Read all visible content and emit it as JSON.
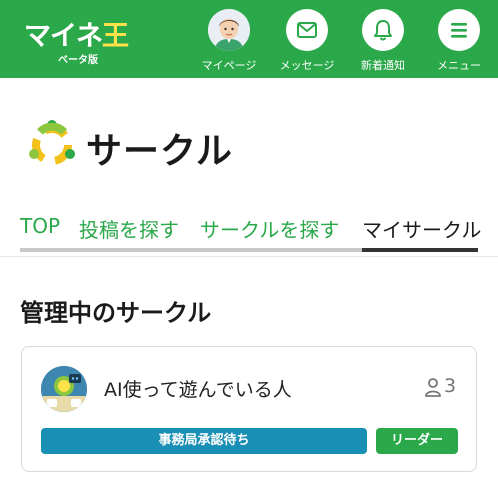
{
  "header": {
    "logo_text_main": "マイネ",
    "logo_text_accent": "王",
    "logo_sub": "ベータ版",
    "nav": [
      {
        "label": "マイページ",
        "icon": "avatar"
      },
      {
        "label": "メッセージ",
        "icon": "mail-icon"
      },
      {
        "label": "新着通知",
        "icon": "bell-icon"
      },
      {
        "label": "メニュー",
        "icon": "menu-icon"
      }
    ]
  },
  "page": {
    "title": "サークル"
  },
  "tabs": [
    {
      "label": "TOP",
      "active": false
    },
    {
      "label": "投稿を探す",
      "active": false
    },
    {
      "label": "サークルを探す",
      "active": false
    },
    {
      "label": "マイサークル",
      "active": true
    }
  ],
  "section": {
    "title": "管理中のサークル"
  },
  "circles": [
    {
      "name": "AI使って遊んでいる人",
      "member_count": "3",
      "status": "事務局承認待ち",
      "role": "リーダー"
    }
  ],
  "colors": {
    "brand_green": "#2aa84a",
    "status_blue": "#1a8fb5",
    "logo_yellow": "#ffe14a"
  }
}
